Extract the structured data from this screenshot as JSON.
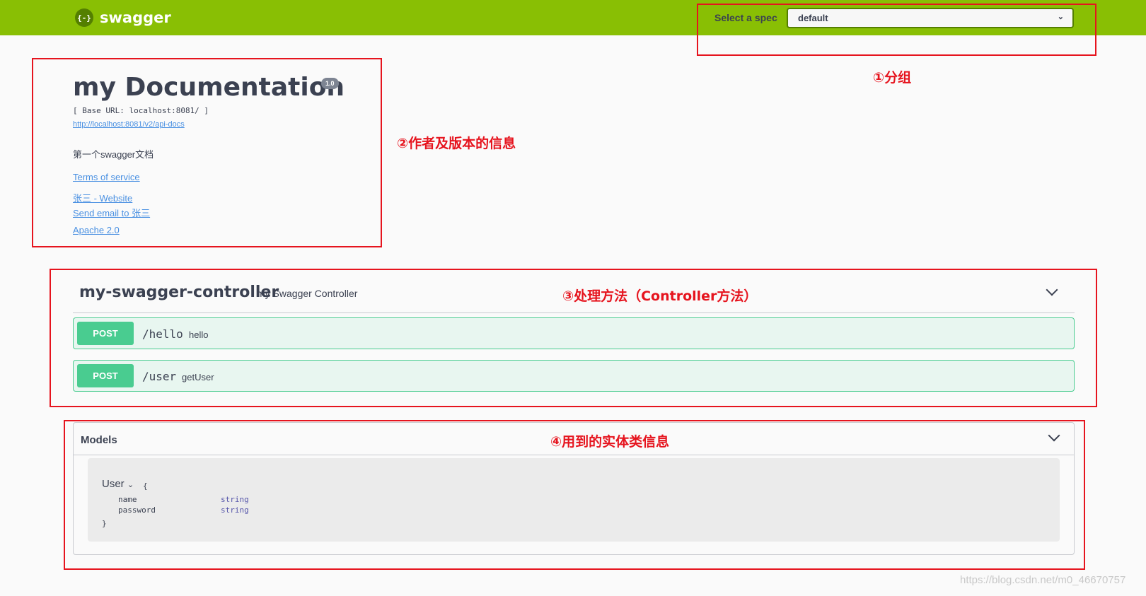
{
  "topbar": {
    "logo_glyph": "{-}",
    "logo_text": "swagger",
    "spec_label": "Select a spec",
    "spec_value": "default"
  },
  "info": {
    "title": "my Documentation",
    "version": "1.0",
    "base_url": "[ Base URL: localhost:8081/ ]",
    "api_docs_link": "http://localhost:8081/v2/api-docs",
    "description": "第一个swagger文档",
    "terms": "Terms of service",
    "contact_website": "张三 - Website",
    "contact_email": "Send email to 张三",
    "license": "Apache 2.0"
  },
  "controller": {
    "name": "my-swagger-controller",
    "description": "my Swagger Controller",
    "operations": [
      {
        "method": "POST",
        "path": "/hello",
        "summary": "hello"
      },
      {
        "method": "POST",
        "path": "/user",
        "summary": "getUser"
      }
    ]
  },
  "models": {
    "title": "Models",
    "model_name": "User",
    "open_brace": "{",
    "close_brace": "}",
    "properties": [
      {
        "name": "name",
        "type": "string"
      },
      {
        "name": "password",
        "type": "string"
      }
    ]
  },
  "annotations": {
    "group": "①分组",
    "info": "②作者及版本的信息",
    "methods": "③处理方法（Controller方法）",
    "models": "④用到的实体类信息"
  },
  "watermark": "https://blog.csdn.net/m0_46670757",
  "colors": {
    "topbar": "#89bf04",
    "post": "#49cc90",
    "annotation": "#e6141e",
    "link": "#4990e2"
  }
}
